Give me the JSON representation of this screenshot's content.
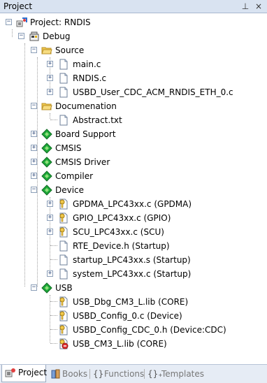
{
  "panel": {
    "title": "Project",
    "pin_glyph": "⊥",
    "close_glyph": "×"
  },
  "tree": {
    "project": "Project: RNDIS",
    "target": "Debug",
    "groups": {
      "source": "Source",
      "documentation": "Documenation",
      "board_support": "Board Support",
      "cmsis": "CMSIS",
      "cmsis_driver": "CMSIS Driver",
      "compiler": "Compiler",
      "device": "Device",
      "usb": "USB"
    },
    "files": {
      "main_c": "main.c",
      "rndis_c": "RNDIS.c",
      "usbd_user": "USBD_User_CDC_ACM_RNDIS_ETH_0.c",
      "abstract": "Abstract.txt",
      "gpdma": "GPDMA_LPC43xx.c (GPDMA)",
      "gpio": "GPIO_LPC43xx.c (GPIO)",
      "scu": "SCU_LPC43xx.c (SCU)",
      "rte_device": "RTE_Device.h (Startup)",
      "startup": "startup_LPC43xx.s (Startup)",
      "system": "system_LPC43xx.c (Startup)",
      "usb_dbg": "USB_Dbg_CM3_L.lib (CORE)",
      "usbd_config": "USBD_Config_0.c (Device)",
      "usbd_config_cdc": "USBD_Config_CDC_0.h (Device:CDC)",
      "usb_cm3": "USB_CM3_L.lib (CORE)"
    }
  },
  "tabs": {
    "project": "Project",
    "books": "Books",
    "functions": "Functions",
    "templates": "Templates"
  },
  "colors": {
    "folder": "#f2c94c",
    "diamond": "#1faa3a",
    "titlebar": "#d9e3f1",
    "tabbar": "#e6ecf5"
  }
}
